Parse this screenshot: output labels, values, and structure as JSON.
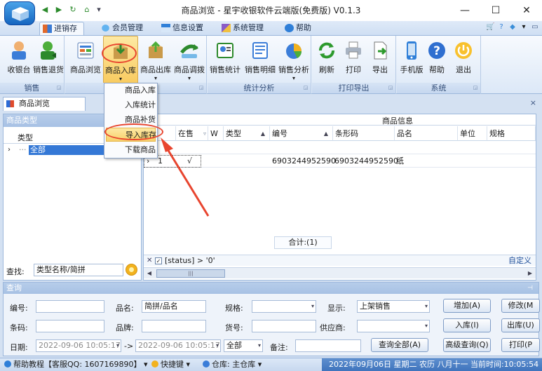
{
  "window": {
    "title": "商品浏览 - 星宇收银软件云端版(免费版) V0.1.3",
    "minimize": "—",
    "maximize": "☐",
    "close": "✕"
  },
  "tabs": [
    {
      "label": "进销存"
    },
    {
      "label": "会员管理"
    },
    {
      "label": "信息设置"
    },
    {
      "label": "系统管理"
    },
    {
      "label": "帮助"
    }
  ],
  "ribbon": {
    "groups": [
      {
        "label": "销售"
      },
      {
        "label": ""
      },
      {
        "label": "统计分析"
      },
      {
        "label": "打印导出"
      },
      {
        "label": "系统"
      }
    ],
    "buttons": {
      "cashier": "收银台",
      "sales_return": "销售退货",
      "goods_browse": "商品浏览",
      "goods_in": "商品入库",
      "goods_out": "商品出库",
      "goods_transfer": "商品调拨",
      "sales_stats": "销售统计",
      "sales_detail": "销售明细",
      "sales_analysis": "销售分析",
      "refresh": "刷新",
      "print": "打印",
      "export": "导出",
      "mobile": "手机版",
      "help": "帮助",
      "exit": "退出"
    }
  },
  "menu": {
    "items": [
      "商品入库",
      "入库统计",
      "商品补货",
      "导入库存",
      "下载商品"
    ]
  },
  "doc_tab": {
    "label": "商品浏览",
    "close": "×"
  },
  "left_panel": {
    "title": "商品类型",
    "column": "类型",
    "row_label": "全部",
    "search_label": "查找:",
    "search_placeholder": "类型名称/简拼"
  },
  "grid": {
    "group_header": "商品信息",
    "columns": [
      "在售",
      "W",
      "类型",
      "编号",
      "条形码",
      "品名",
      "单位",
      "规格"
    ],
    "rows": [
      {
        "index": "1",
        "on_sale": "√",
        "w": "",
        "type": "",
        "code": "6903244952590",
        "barcode": "6903244952590",
        "name": "纸",
        "unit": "",
        "spec": ""
      }
    ],
    "total": "合计:(1)",
    "filter_text": "[status] > '0'",
    "custom": "自定义"
  },
  "query": {
    "title": "查询",
    "labels": {
      "code": "编号:",
      "name": "品名:",
      "spec": "规格:",
      "show": "显示:",
      "barcode": "条码:",
      "brand": "品牌:",
      "item_no": "货号:",
      "supplier": "供应商:",
      "date": "日期:",
      "remark": "备注:"
    },
    "name_value": "简拼/品名",
    "show_value": "上架销售",
    "date_from": "2022-09-06 10:05:17",
    "date_to": "2022-09-06 10:05:17",
    "date_arrow": "->",
    "range_value": "全部",
    "buttons": {
      "add": "增加(A)",
      "modify": "修改(M",
      "stock_in": "入库(I)",
      "stock_out": "出库(U)",
      "query_all": "查询全部(A)",
      "advanced": "高级查询(Q)",
      "print": "打印(P"
    }
  },
  "status": {
    "help": "帮助教程【客服QQ: 1607169890】",
    "shortcut": "快捷键",
    "warehouse": "仓库: 主仓库",
    "datetime": "2022年09月06日 星期二 农历 八月十一 当前时间:10:05:54"
  }
}
